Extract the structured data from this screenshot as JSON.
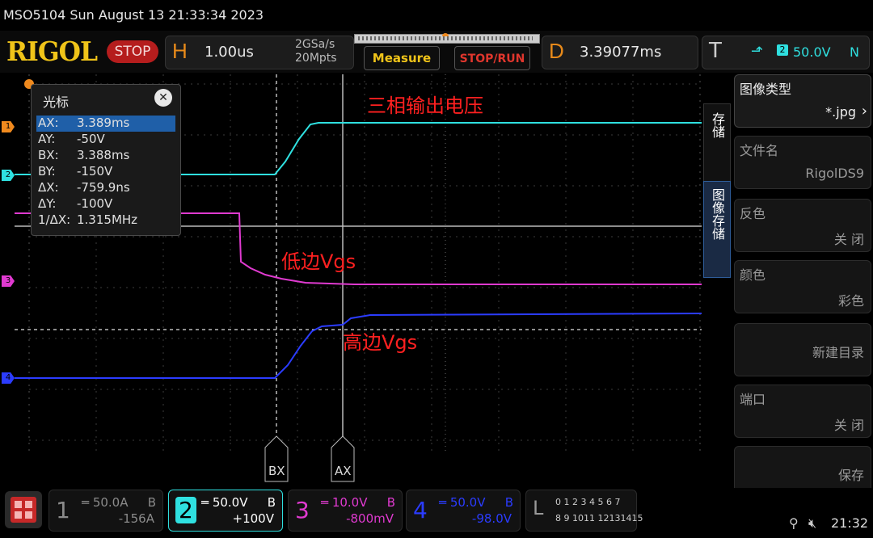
{
  "title_bar": {
    "text": "MSO5104  Sun August 13 21:33:34 2023"
  },
  "toolbar": {
    "logo": "RIGOL",
    "run_state": "STOP",
    "horizontal": {
      "letter": "H",
      "timebase": "1.00us",
      "sample_rate": "2GSa/s",
      "memory_depth": "20Mpts"
    },
    "measure_label": "Measure",
    "stop_run_label": "STOP/RUN",
    "delay": {
      "letter": "D",
      "value": "3.39077ms"
    },
    "trigger": {
      "letter": "T",
      "level": "50.0V",
      "mode": "N",
      "source": "2"
    }
  },
  "cursor_panel": {
    "title": "光标",
    "rows": [
      {
        "k": "AX:",
        "v": "3.389ms"
      },
      {
        "k": "AY:",
        "v": "-50V"
      },
      {
        "k": "BX:",
        "v": "3.388ms"
      },
      {
        "k": "BY:",
        "v": "-150V"
      },
      {
        "k": "ΔX:",
        "v": "-759.9ns"
      },
      {
        "k": "ΔY:",
        "v": "-100V"
      },
      {
        "k": "1/ΔX:",
        "v": "1.315MHz"
      }
    ]
  },
  "annotations": {
    "three_phase": "三相输出电压",
    "low_vgs": "低边Vgs",
    "high_vgs": "高边Vgs"
  },
  "cursor_labels": {
    "bx": "BX",
    "ax": "AX"
  },
  "channel_markers": {
    "ch1": "1",
    "ch2": "2",
    "ch3": "3",
    "ch4": "4"
  },
  "right_menu": {
    "tab_store": "存储",
    "tab_image_store": "图像存储",
    "items": [
      {
        "title": "图像类型",
        "value": "*.jpg"
      },
      {
        "title": "文件名",
        "value": "RigolDS9"
      },
      {
        "title": "反色",
        "value": "关 闭"
      },
      {
        "title": "颜色",
        "value": "彩色"
      },
      {
        "title": "",
        "value": "新建目录"
      },
      {
        "title": "端口",
        "value": "关 闭"
      },
      {
        "title": "",
        "value": "保存"
      }
    ]
  },
  "channels": [
    {
      "num": "1",
      "scale": "50.0A",
      "b": "B",
      "offset": "-156A",
      "color": "#8a8a8a"
    },
    {
      "num": "2",
      "scale": "50.0V",
      "b": "B",
      "offset": "+100V",
      "color": "#2fe0e0"
    },
    {
      "num": "3",
      "scale": "10.0V",
      "b": "B",
      "offset": "-800mV",
      "color": "#e03ad0"
    },
    {
      "num": "4",
      "scale": "50.0V",
      "b": "B",
      "offset": "-98.0V",
      "color": "#2b3cff"
    }
  ],
  "digital": {
    "letter": "L",
    "row1": "0 1 2 3 4 5 6 7",
    "row2": "8 9 1011 12131415"
  },
  "status": {
    "time": "21:32"
  },
  "colors": {
    "ch2": "#2fe0e0",
    "ch3": "#e03ad0",
    "ch4": "#2b3cff",
    "accent": "#f08a1e",
    "logo": "#f0c419"
  }
}
